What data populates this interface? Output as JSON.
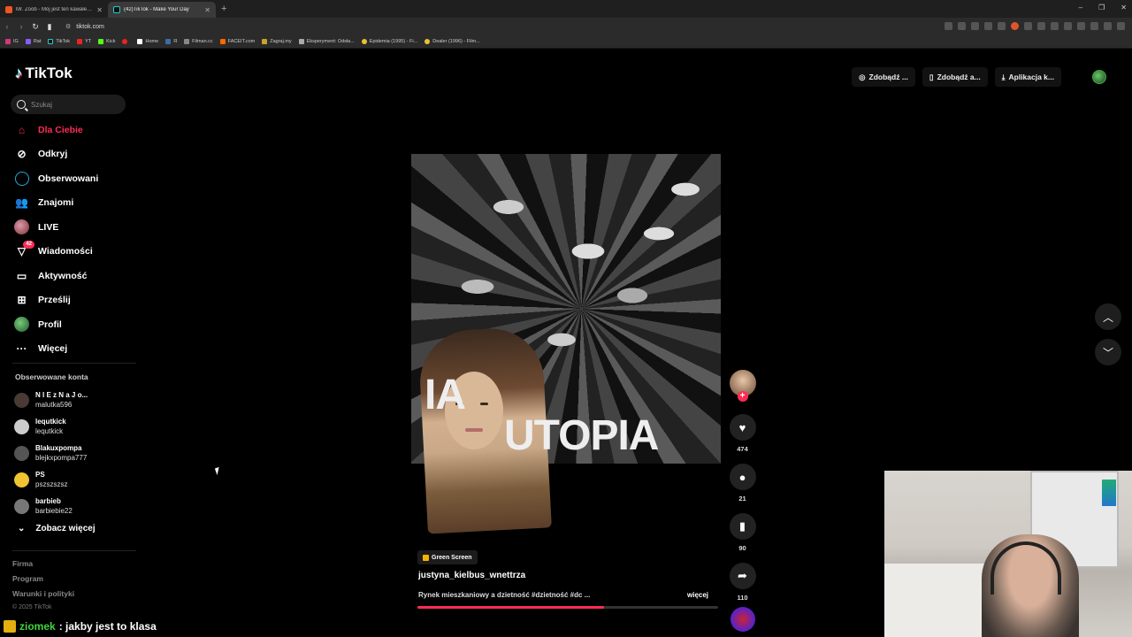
{
  "browser": {
    "tabs": [
      {
        "title": "Mr. Zoob - Mój jest ten kawałek podł",
        "active": false
      },
      {
        "title": "(42)TikTok - Make Your Day",
        "active": true
      }
    ],
    "new_tab": "+",
    "window_controls": [
      "–",
      "❐",
      "✕"
    ],
    "url": "tiktok.com",
    "bookmarks": [
      "IG",
      "Rat",
      "TikTok",
      "YT",
      "Kick",
      "",
      "Home",
      "Я",
      "Filman.cc",
      "FACEIT.com",
      "Zagraj.my",
      "Eksperyment: Odsła...",
      "Epidemia (1995) - Fi...",
      "Dealer (1996) - Film..."
    ]
  },
  "tiktok": {
    "logo": "TikTok",
    "search_placeholder": "Szukaj",
    "menu": [
      {
        "label": "Dla Ciebie",
        "icon": "home-icon",
        "active": true
      },
      {
        "label": "Odkryj",
        "icon": "compass-icon"
      },
      {
        "label": "Obserwowani",
        "icon": "following-icon"
      },
      {
        "label": "Znajomi",
        "icon": "friends-icon"
      },
      {
        "label": "LIVE",
        "icon": "live-icon"
      },
      {
        "label": "Wiadomości",
        "icon": "messages-icon",
        "badge": "42"
      },
      {
        "label": "Aktywność",
        "icon": "activity-icon"
      },
      {
        "label": "Prześlij",
        "icon": "upload-icon"
      },
      {
        "label": "Profil",
        "icon": "profile-icon"
      },
      {
        "label": "Więcej",
        "icon": "more-icon"
      }
    ],
    "followed_title": "Obserwowane konta",
    "followed": [
      {
        "display": "N I E z N a J o...",
        "user": "malutka596",
        "color": "#4a3a35"
      },
      {
        "display": "lequtkick",
        "user": "lequtkick",
        "color": "#ccc"
      },
      {
        "display": "Blakuxpompa",
        "user": "blejkxpompa777",
        "color": "#555"
      },
      {
        "display": "PS",
        "user": "pszszszsz",
        "color": "#f1c232"
      },
      {
        "display": "barbieb",
        "user": "barbiebie22",
        "color": "#777"
      }
    ],
    "see_more": "Zobacz więcej",
    "footer": [
      "Firma",
      "Program",
      "Warunki i polityki"
    ],
    "copyright": "© 2025 TikTok",
    "top_actions": [
      "Zdobądź ...",
      "Zdobądź a...",
      "Aplikacja k..."
    ],
    "video": {
      "overlay_line1": "IA",
      "overlay_line2": "UTOPIA",
      "effect_badge": "Green Screen",
      "author": "justyna_kielbus_wnettrza",
      "caption": "Rynek mieszkaniowy a dzietność #dzietność #dc ...",
      "more": "więcej",
      "progress": 0.62
    },
    "actions": {
      "likes": "474",
      "comments": "21",
      "saves": "90",
      "shares": "110"
    }
  },
  "chat": {
    "user": "ziomek",
    "message": ": jakby jest to klasa"
  }
}
